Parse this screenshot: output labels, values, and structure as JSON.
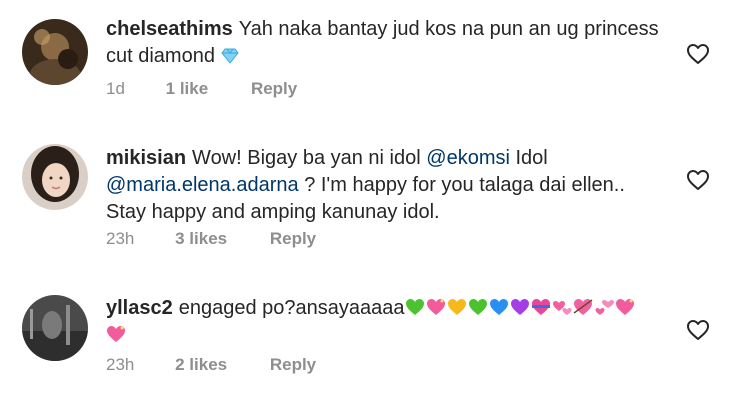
{
  "comments": [
    {
      "username": "chelseathims",
      "text": "Yah naka bantay jud kos na pun an ug princess cut diamond",
      "emoji": "💎",
      "time": "1d",
      "likes": "1 like",
      "reply": "Reply"
    },
    {
      "username": "mikisian",
      "text_a": "Wow! Bigay ba yan ni idol",
      "mention_a": "@ekomsi",
      "text_b": " Idol",
      "mention_b": "@maria.elena.adarna",
      "text_c": " ? I'm happy for you talaga dai ellen.. Stay happy and amping kanunay idol.",
      "time": "23h",
      "likes": "3 likes",
      "reply": "Reply"
    },
    {
      "username": "yllasc2",
      "text": "engaged po?ansayaaaaa",
      "emojis": [
        "green-heart",
        "sparkling-heart",
        "yellow-heart",
        "green-heart",
        "blue-heart",
        "purple-heart",
        "heart-ribbon",
        "revolving-hearts",
        "heart-arrow",
        "two-hearts",
        "sparkling-heart",
        "sparkling-heart"
      ],
      "time": "23h",
      "likes": "2 likes",
      "reply": "Reply"
    }
  ]
}
